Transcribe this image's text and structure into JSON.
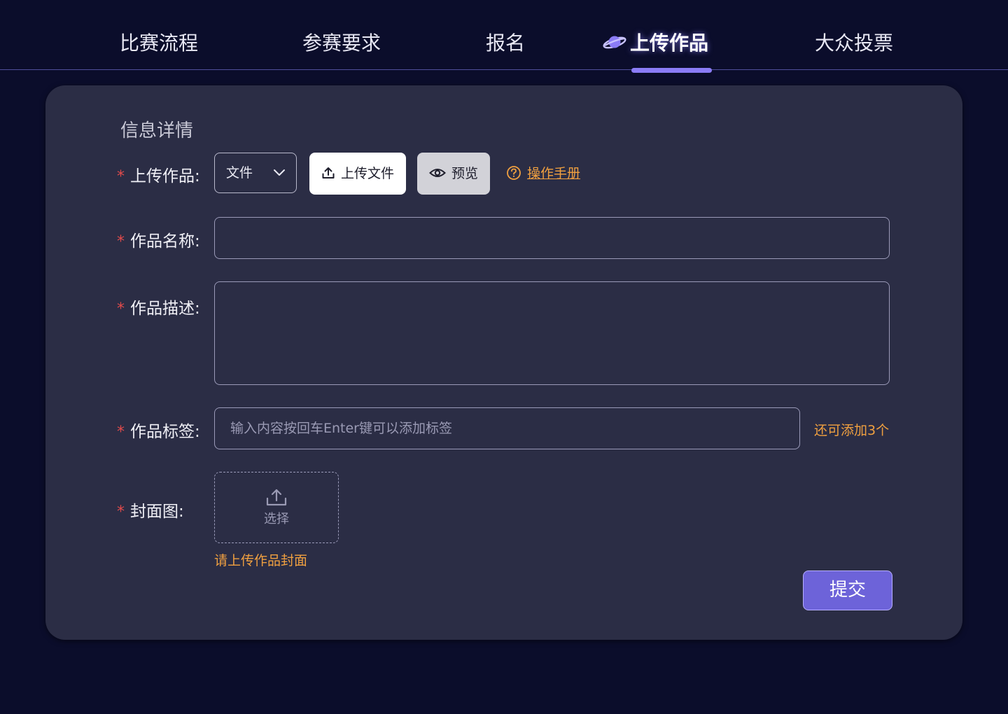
{
  "nav": {
    "tabs": [
      {
        "label": "比赛流程"
      },
      {
        "label": "参赛要求"
      },
      {
        "label": "报名"
      },
      {
        "label": "上传作品"
      },
      {
        "label": "大众投票"
      }
    ],
    "active_icon": "planet-icon"
  },
  "form": {
    "section_title": "信息详情",
    "required_mark": "*",
    "upload": {
      "label": "上传作品:",
      "type_select_value": "文件",
      "upload_button": "上传文件",
      "preview_button": "预览",
      "manual_link": "操作手册"
    },
    "name": {
      "label": "作品名称:",
      "value": ""
    },
    "description": {
      "label": "作品描述:",
      "value": ""
    },
    "tags": {
      "label": "作品标签:",
      "placeholder": "输入内容按回车Enter键可以添加标签",
      "remaining_text": "还可添加3个"
    },
    "cover": {
      "label": "封面图:",
      "select_text": "选择",
      "hint": "请上传作品封面"
    },
    "submit_button": "提交"
  },
  "colors": {
    "background": "#0b0d2b",
    "card": "#2b2d45",
    "accent": "#8b7cf6",
    "submit": "#6d63d9",
    "warning_text": "#f0a040",
    "required": "#e14b4b"
  }
}
